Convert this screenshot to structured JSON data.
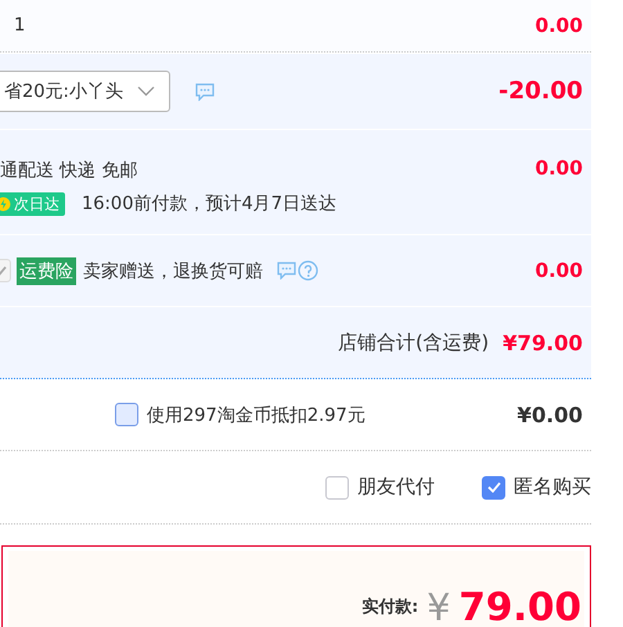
{
  "item_row": {
    "quantity": "1",
    "amount": "0.00"
  },
  "coupon_row": {
    "coupon": "省20元:小丫头",
    "amount": "-20.00"
  },
  "shipping_row": {
    "method": "通配送 快递 免邮",
    "badge": "次日达",
    "eta": "16:00前付款，预计4月7日送达",
    "amount": "0.00"
  },
  "insurance_row": {
    "checked": true,
    "disabled": true,
    "tag": "运费险",
    "text": "卖家赠送，退换货可赔",
    "amount": "0.00"
  },
  "store_total": {
    "label": "店铺合计(含运费)",
    "amount": "¥79.00"
  },
  "coins_row": {
    "checked": false,
    "label": "使用297淘金币抵扣2.97元",
    "amount": "¥0.00"
  },
  "options": [
    {
      "label": "朋友代付",
      "checked": false
    },
    {
      "label": "匿名购买",
      "checked": true
    }
  ],
  "payment": {
    "label": "实付款:",
    "currency": "¥",
    "amount": "79.00"
  }
}
